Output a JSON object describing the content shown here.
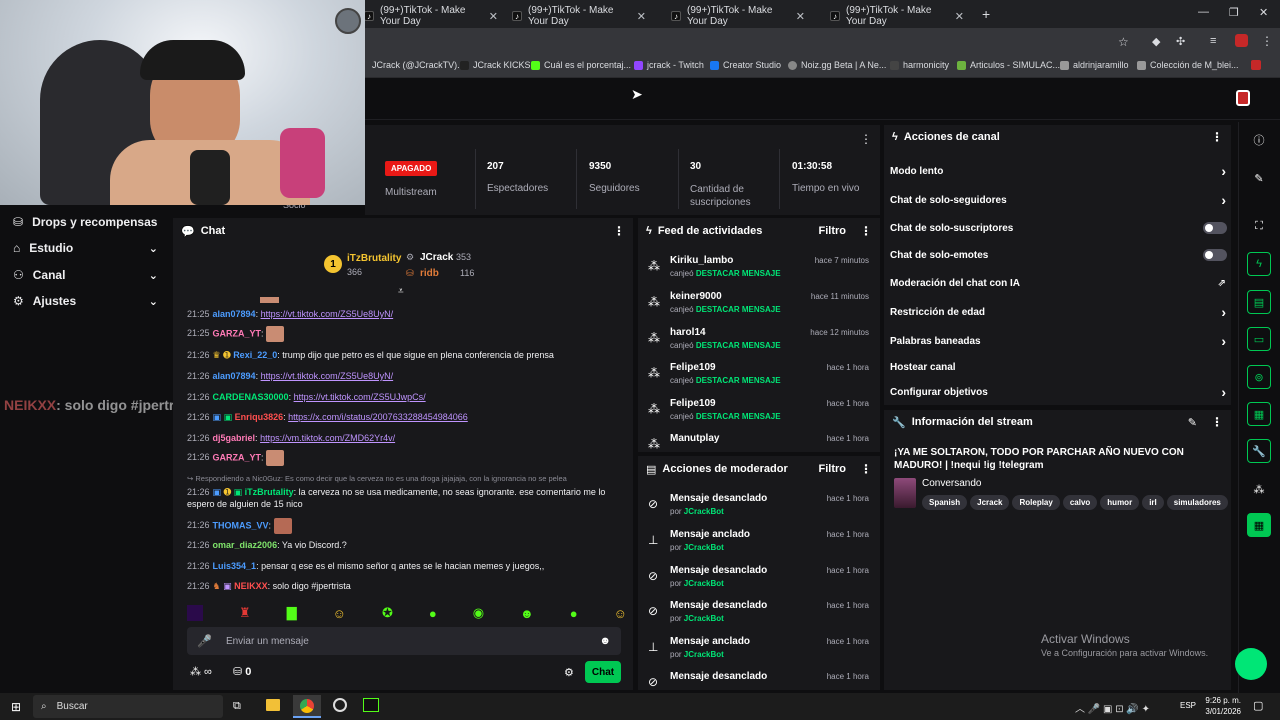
{
  "browser": {
    "tabs": [
      {
        "label": "(99+)TikTok - Make Your Day"
      },
      {
        "label": "(99+)TikTok - Make Your Day"
      },
      {
        "label": "(99+)TikTok - Make Your Day"
      },
      {
        "label": "(99+)TikTok - Make Your Day"
      }
    ],
    "bookmarks": [
      "JCrack (@JCrackTV)...",
      "JCrack KICKS",
      "Cuál es el porcentaj...",
      "jcrack - Twitch",
      "Creator Studio",
      "Noiz.gg Beta | A Ne...",
      "harmonicity",
      "Articulos - SIMULAC...",
      "aldrinjaramillo",
      "Colección de M_blei..."
    ]
  },
  "left_nav": [
    {
      "label": "Drops y recompensas",
      "icon": "gift-icon",
      "chevron": false
    },
    {
      "label": "Estudio",
      "icon": "studio-icon",
      "chevron": true
    },
    {
      "label": "Canal",
      "icon": "channel-icon",
      "chevron": true
    },
    {
      "label": "Ajustes",
      "icon": "gear-icon",
      "chevron": true
    }
  ],
  "left_nav_overflow_label": "Socio",
  "overlay_chat": {
    "user": "NEIKXX",
    "text": ": solo digo #jpertrista"
  },
  "stats": {
    "live_badge": "APAGADO",
    "multistream_label": "Multistream",
    "viewers_value": "207",
    "viewers_label": "Espectadores",
    "followers_value": "9350",
    "followers_label": "Seguidores",
    "subs_value": "30",
    "subs_label": "Cantidad de suscripciones",
    "uptime_value": "01:30:58",
    "uptime_label": "Tiempo en vivo"
  },
  "chat": {
    "title": "Chat",
    "leaderboard": [
      {
        "rank": "1",
        "name": "iTzBrutality",
        "value": "366"
      },
      {
        "name": "JCrack",
        "value": "353"
      },
      {
        "name": "ridb",
        "value": "116"
      }
    ],
    "messages": [
      {
        "time": "21:25",
        "user": "alan07894",
        "color": "#4c9cff",
        "text": "",
        "link": "https://vt.tiktok.com/ZS5Ue8UyN/"
      },
      {
        "time": "21:25",
        "user": "GARZA_YT",
        "color": "#ff7ab6",
        "text": "",
        "link": ""
      },
      {
        "time": "21:26",
        "user": "Rexi_22_0",
        "color": "#4c9cff",
        "text": ": trump dijo que petro es el que sigue en plena conferencia de prensa",
        "link": ""
      },
      {
        "time": "21:26",
        "user": "alan07894",
        "color": "#4c9cff",
        "text": "",
        "link": "https://vt.tiktok.com/ZS5Ue8UyN/"
      },
      {
        "time": "21:26",
        "user": "CARDENAS30000",
        "color": "#00e676",
        "text": "",
        "link": "https://vt.tiktok.com/ZS5UJwpCs/"
      },
      {
        "time": "21:26",
        "user": "Enriqu3826",
        "color": "#ff4f4f",
        "text": "",
        "link": "https://x.com/i/status/2007633288454984066"
      },
      {
        "time": "21:26",
        "user": "dj5gabriel",
        "color": "#ff7ab6",
        "text": "",
        "link": "https://vm.tiktok.com/ZMD62Yr4v/"
      },
      {
        "time": "21:26",
        "user": "GARZA_YT",
        "color": "#ff7ab6",
        "text": "",
        "link": ""
      },
      {
        "time": "21:26",
        "user": "THOMAS_VV",
        "color": "#4c9cff",
        "text": "",
        "link": ""
      },
      {
        "time": "21:26",
        "user": "omar_diaz2006",
        "color": "#7fe36b",
        "text": ": Ya vio Discord.?",
        "link": ""
      },
      {
        "time": "21:26",
        "user": "Luis354_1",
        "color": "#4c9cff",
        "text": ": pensar q ese es el mismo señor q antes se le hacian memes y juegos,,",
        "link": ""
      },
      {
        "time": "21:26",
        "user": "NEIKXX",
        "color": "#ff4f4f",
        "text": ": solo digo #jpertrista",
        "link": ""
      }
    ],
    "reply_context": "Respondiendo a Nic0Guz: Es como decir que la cerveza no es una droga jajajaja, con la ignorancia no se pelea",
    "reply_time": "21:26",
    "reply_user": "iTzBrutality",
    "reply_text": ": la cerveza no se usa medicamente, no seas ignorante. ese comentario me lo espero de alguien de 15 nico",
    "input_placeholder": "Enviar un mensaje",
    "points_value": "0",
    "send_label": "Chat"
  },
  "activity_feed": {
    "title": "Feed de actividades",
    "filter_label": "Filtro",
    "items": [
      {
        "user": "Kiriku_lambo",
        "action": "canjeó",
        "reward": "DESTACAR MENSAJE",
        "time": "hace 7 minutos"
      },
      {
        "user": "keiner9000",
        "action": "canjeó",
        "reward": "DESTACAR MENSAJE",
        "time": "hace 11 minutos"
      },
      {
        "user": "harol14",
        "action": "canjeó",
        "reward": "DESTACAR MENSAJE",
        "time": "hace 12 minutos"
      },
      {
        "user": "Felipe109",
        "action": "canjeó",
        "reward": "DESTACAR MENSAJE",
        "time": "hace 1 hora"
      },
      {
        "user": "Felipe109",
        "action": "canjeó",
        "reward": "DESTACAR MENSAJE",
        "time": "hace 1 hora"
      },
      {
        "user": "Manutplay",
        "action": "",
        "reward": "",
        "time": "hace 1 hora"
      }
    ]
  },
  "mod_actions": {
    "title": "Acciones de moderador",
    "filter_label": "Filtro",
    "items": [
      {
        "action": "Mensaje desanclado",
        "by": "por",
        "mod": "JCrackBot",
        "time": "hace 1 hora",
        "icon": "unpin-icon"
      },
      {
        "action": "Mensaje anclado",
        "by": "por",
        "mod": "JCrackBot",
        "time": "hace 1 hora",
        "icon": "pin-icon"
      },
      {
        "action": "Mensaje desanclado",
        "by": "por",
        "mod": "JCrackBot",
        "time": "hace 1 hora",
        "icon": "unpin-icon"
      },
      {
        "action": "Mensaje desanclado",
        "by": "por",
        "mod": "JCrackBot",
        "time": "hace 1 hora",
        "icon": "unpin-icon"
      },
      {
        "action": "Mensaje anclado",
        "by": "por",
        "mod": "JCrackBot",
        "time": "hace 1 hora",
        "icon": "pin-icon"
      },
      {
        "action": "Mensaje desanclado",
        "by": "",
        "mod": "",
        "time": "hace 1 hora",
        "icon": "unpin-icon"
      }
    ]
  },
  "channel_actions": {
    "title": "Acciones de canal",
    "items": [
      {
        "label": "Modo lento",
        "control": "chevron"
      },
      {
        "label": "Chat de solo-seguidores",
        "control": "chevron"
      },
      {
        "label": "Chat de solo-suscriptores",
        "control": "toggle"
      },
      {
        "label": "Chat de solo-emotes",
        "control": "toggle"
      },
      {
        "label": "Moderación del chat con IA",
        "control": "external"
      },
      {
        "label": "Restricción de edad",
        "control": "chevron"
      },
      {
        "label": "Palabras baneadas",
        "control": "chevron"
      },
      {
        "label": "Hostear canal",
        "control": "none"
      },
      {
        "label": "Configurar objetivos",
        "control": "chevron"
      }
    ]
  },
  "stream_info": {
    "title": "Información del stream",
    "stream_title": "¡YA ME SOLTARON, TODO POR PARCHAR AÑO NUEVO CON MADURO! | !nequi !ig !telegram",
    "category": "Conversando",
    "tags": [
      "Spanish",
      "Jcrack",
      "Roleplay",
      "calvo",
      "humor",
      "irl",
      "simuladores"
    ]
  },
  "watermark": {
    "line1": "Activar Windows",
    "line2": "Ve a Configuración para activar Windows."
  },
  "taskbar": {
    "search_placeholder": "Buscar",
    "language": "ESP",
    "time": "9:26 p. m.",
    "date": "3/01/2026"
  },
  "colors": {
    "accent": "#00e676",
    "live_red": "#e91916",
    "panel": "#18181b",
    "bg": "#0e0e10"
  }
}
